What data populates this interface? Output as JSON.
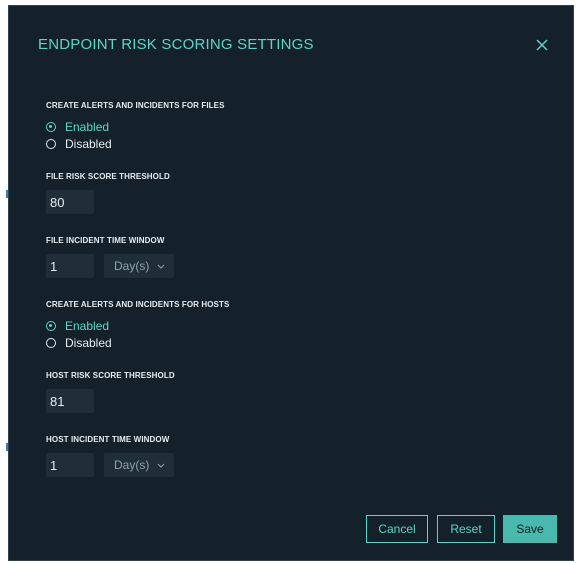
{
  "dialog": {
    "title": "ENDPOINT RISK SCORING SETTINGS",
    "close_icon": "close-icon"
  },
  "files": {
    "alerts_label": "CREATE ALERTS AND INCIDENTS FOR FILES",
    "enabled_label": "Enabled",
    "disabled_label": "Disabled",
    "selected": "enabled",
    "threshold_label": "FILE RISK SCORE THRESHOLD",
    "threshold_value": "80",
    "window_label": "FILE INCIDENT TIME WINDOW",
    "window_value": "1",
    "window_unit": "Day(s)"
  },
  "hosts": {
    "alerts_label": "CREATE ALERTS AND INCIDENTS FOR HOSTS",
    "enabled_label": "Enabled",
    "disabled_label": "Disabled",
    "selected": "enabled",
    "threshold_label": "HOST RISK SCORE THRESHOLD",
    "threshold_value": "81",
    "window_label": "HOST INCIDENT TIME WINDOW",
    "window_value": "1",
    "window_unit": "Day(s)"
  },
  "footer": {
    "cancel_label": "Cancel",
    "reset_label": "Reset",
    "save_label": "Save"
  },
  "colors": {
    "background": "#14212b",
    "accent": "#5cd6c8",
    "field": "#1f2e39",
    "text": "#e6ecef"
  }
}
